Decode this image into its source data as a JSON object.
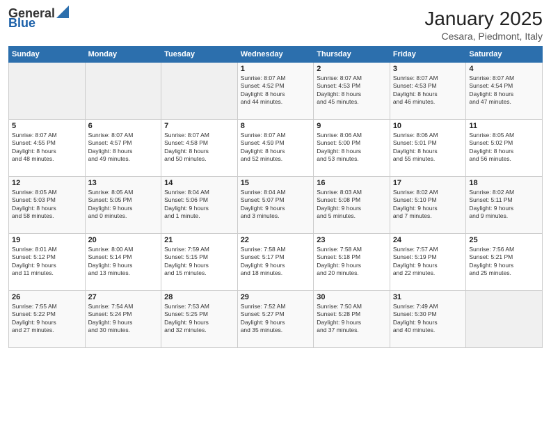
{
  "header": {
    "logo_general": "General",
    "logo_blue": "Blue",
    "title": "January 2025",
    "subtitle": "Cesara, Piedmont, Italy"
  },
  "days_of_week": [
    "Sunday",
    "Monday",
    "Tuesday",
    "Wednesday",
    "Thursday",
    "Friday",
    "Saturday"
  ],
  "weeks": [
    [
      {
        "day": "",
        "info": ""
      },
      {
        "day": "",
        "info": ""
      },
      {
        "day": "",
        "info": ""
      },
      {
        "day": "1",
        "info": "Sunrise: 8:07 AM\nSunset: 4:52 PM\nDaylight: 8 hours\nand 44 minutes."
      },
      {
        "day": "2",
        "info": "Sunrise: 8:07 AM\nSunset: 4:53 PM\nDaylight: 8 hours\nand 45 minutes."
      },
      {
        "day": "3",
        "info": "Sunrise: 8:07 AM\nSunset: 4:53 PM\nDaylight: 8 hours\nand 46 minutes."
      },
      {
        "day": "4",
        "info": "Sunrise: 8:07 AM\nSunset: 4:54 PM\nDaylight: 8 hours\nand 47 minutes."
      }
    ],
    [
      {
        "day": "5",
        "info": "Sunrise: 8:07 AM\nSunset: 4:55 PM\nDaylight: 8 hours\nand 48 minutes."
      },
      {
        "day": "6",
        "info": "Sunrise: 8:07 AM\nSunset: 4:57 PM\nDaylight: 8 hours\nand 49 minutes."
      },
      {
        "day": "7",
        "info": "Sunrise: 8:07 AM\nSunset: 4:58 PM\nDaylight: 8 hours\nand 50 minutes."
      },
      {
        "day": "8",
        "info": "Sunrise: 8:07 AM\nSunset: 4:59 PM\nDaylight: 8 hours\nand 52 minutes."
      },
      {
        "day": "9",
        "info": "Sunrise: 8:06 AM\nSunset: 5:00 PM\nDaylight: 8 hours\nand 53 minutes."
      },
      {
        "day": "10",
        "info": "Sunrise: 8:06 AM\nSunset: 5:01 PM\nDaylight: 8 hours\nand 55 minutes."
      },
      {
        "day": "11",
        "info": "Sunrise: 8:05 AM\nSunset: 5:02 PM\nDaylight: 8 hours\nand 56 minutes."
      }
    ],
    [
      {
        "day": "12",
        "info": "Sunrise: 8:05 AM\nSunset: 5:03 PM\nDaylight: 8 hours\nand 58 minutes."
      },
      {
        "day": "13",
        "info": "Sunrise: 8:05 AM\nSunset: 5:05 PM\nDaylight: 9 hours\nand 0 minutes."
      },
      {
        "day": "14",
        "info": "Sunrise: 8:04 AM\nSunset: 5:06 PM\nDaylight: 9 hours\nand 1 minute."
      },
      {
        "day": "15",
        "info": "Sunrise: 8:04 AM\nSunset: 5:07 PM\nDaylight: 9 hours\nand 3 minutes."
      },
      {
        "day": "16",
        "info": "Sunrise: 8:03 AM\nSunset: 5:08 PM\nDaylight: 9 hours\nand 5 minutes."
      },
      {
        "day": "17",
        "info": "Sunrise: 8:02 AM\nSunset: 5:10 PM\nDaylight: 9 hours\nand 7 minutes."
      },
      {
        "day": "18",
        "info": "Sunrise: 8:02 AM\nSunset: 5:11 PM\nDaylight: 9 hours\nand 9 minutes."
      }
    ],
    [
      {
        "day": "19",
        "info": "Sunrise: 8:01 AM\nSunset: 5:12 PM\nDaylight: 9 hours\nand 11 minutes."
      },
      {
        "day": "20",
        "info": "Sunrise: 8:00 AM\nSunset: 5:14 PM\nDaylight: 9 hours\nand 13 minutes."
      },
      {
        "day": "21",
        "info": "Sunrise: 7:59 AM\nSunset: 5:15 PM\nDaylight: 9 hours\nand 15 minutes."
      },
      {
        "day": "22",
        "info": "Sunrise: 7:58 AM\nSunset: 5:17 PM\nDaylight: 9 hours\nand 18 minutes."
      },
      {
        "day": "23",
        "info": "Sunrise: 7:58 AM\nSunset: 5:18 PM\nDaylight: 9 hours\nand 20 minutes."
      },
      {
        "day": "24",
        "info": "Sunrise: 7:57 AM\nSunset: 5:19 PM\nDaylight: 9 hours\nand 22 minutes."
      },
      {
        "day": "25",
        "info": "Sunrise: 7:56 AM\nSunset: 5:21 PM\nDaylight: 9 hours\nand 25 minutes."
      }
    ],
    [
      {
        "day": "26",
        "info": "Sunrise: 7:55 AM\nSunset: 5:22 PM\nDaylight: 9 hours\nand 27 minutes."
      },
      {
        "day": "27",
        "info": "Sunrise: 7:54 AM\nSunset: 5:24 PM\nDaylight: 9 hours\nand 30 minutes."
      },
      {
        "day": "28",
        "info": "Sunrise: 7:53 AM\nSunset: 5:25 PM\nDaylight: 9 hours\nand 32 minutes."
      },
      {
        "day": "29",
        "info": "Sunrise: 7:52 AM\nSunset: 5:27 PM\nDaylight: 9 hours\nand 35 minutes."
      },
      {
        "day": "30",
        "info": "Sunrise: 7:50 AM\nSunset: 5:28 PM\nDaylight: 9 hours\nand 37 minutes."
      },
      {
        "day": "31",
        "info": "Sunrise: 7:49 AM\nSunset: 5:30 PM\nDaylight: 9 hours\nand 40 minutes."
      },
      {
        "day": "",
        "info": ""
      }
    ]
  ]
}
